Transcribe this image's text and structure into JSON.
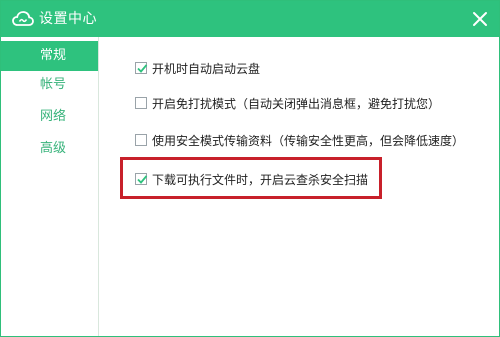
{
  "window": {
    "title": "设置中心",
    "logo_icon": "cloud-icon",
    "close_icon": "close-icon",
    "accent_color": "#2ec27e"
  },
  "sidebar": {
    "items": [
      {
        "label": "常规",
        "active": true
      },
      {
        "label": "帐号",
        "active": false
      },
      {
        "label": "网络",
        "active": false
      },
      {
        "label": "高级",
        "active": false
      }
    ]
  },
  "options": [
    {
      "label": "开机时自动启动云盘",
      "checked": true
    },
    {
      "label": "开启免打扰模式（自动关闭弹出消息框，避免打扰您）",
      "checked": false
    },
    {
      "label": "使用安全模式传输资料（传输安全性更高，但会降低速度）",
      "checked": false
    },
    {
      "label": "下载可执行文件时，开启云查杀安全扫描",
      "checked": true
    }
  ],
  "highlight_color": "#c8202a"
}
